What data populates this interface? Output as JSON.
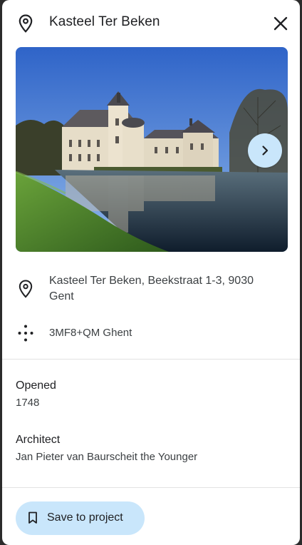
{
  "header": {
    "title": "Kasteel Ter Beken"
  },
  "photo": {
    "subject": "Kasteel Ter Beken castle reflected in moat"
  },
  "details": {
    "address": "Kasteel Ter Beken, Beekstraat 1-3, 9030 Gent",
    "plus_code": "3MF8+QM Ghent"
  },
  "facts": {
    "opened_label": "Opened",
    "opened_value": "1748",
    "architect_label": "Architect",
    "architect_value": "Jan Pieter van Baurscheit the Younger"
  },
  "actions": {
    "save_label": "Save to project"
  },
  "colors": {
    "accent_button": "#c9e6fb",
    "text_primary": "#202124",
    "text_secondary": "#3c4043"
  },
  "icons": {
    "header": "location-pin-icon",
    "close": "close-icon",
    "next": "chevron-right-icon",
    "address": "location-pin-icon",
    "plus_code": "plus-code-icon",
    "save": "bookmark-icon"
  }
}
